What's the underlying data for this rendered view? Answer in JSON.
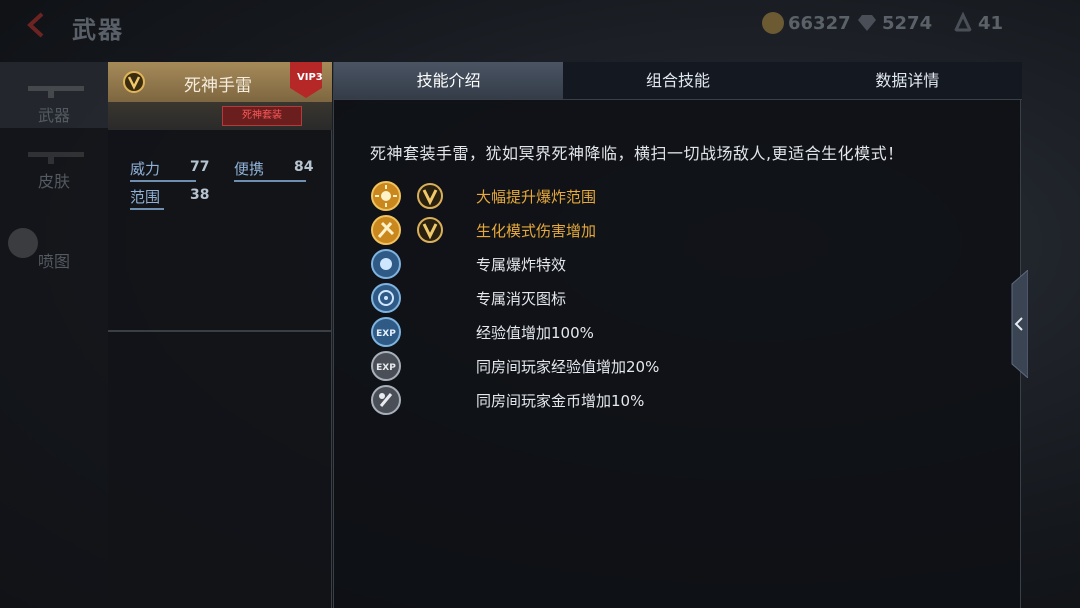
{
  "topbar": {
    "title": "武器",
    "gold": "66327",
    "diamond": "5274",
    "points": "41"
  },
  "leftnav": {
    "items": [
      {
        "label": "武器"
      },
      {
        "label": "皮肤"
      },
      {
        "label": "喷图"
      }
    ]
  },
  "weapon": {
    "name": "死神手雷",
    "vip": "VIP3",
    "set_badge": "死神套装",
    "stats": {
      "power_label": "威力",
      "power_value": "77",
      "portable_label": "便携",
      "portable_value": "84",
      "range_label": "范围",
      "range_value": "38"
    }
  },
  "tabs": [
    "技能介绍",
    "组合技能",
    "数据详情"
  ],
  "description": "死神套装手雷，犹如冥界死神降临，横扫一切战场敌人,更适合生化模式！",
  "skills": [
    {
      "text": "大幅提升爆炸范围",
      "icon": "explosion-range-icon",
      "vip": true
    },
    {
      "text": "生化模式伤害增加",
      "icon": "biohazard-damage-icon",
      "vip": true
    },
    {
      "text": "专属爆炸特效",
      "icon": "explosion-effect-icon",
      "vip": false
    },
    {
      "text": "专属消灭图标",
      "icon": "kill-icon-icon",
      "vip": false
    },
    {
      "text": "经验值增加100%",
      "icon": "exp-icon",
      "vip": false
    },
    {
      "text": "同房间玩家经验值增加20%",
      "icon": "room-exp-icon",
      "vip": false
    },
    {
      "text": "同房间玩家金币增加10%",
      "icon": "room-coin-icon",
      "vip": false
    }
  ],
  "colors": {
    "gold_text": "#e6a93a",
    "tab_active": "#434c59",
    "vip_red": "#c0392b"
  }
}
